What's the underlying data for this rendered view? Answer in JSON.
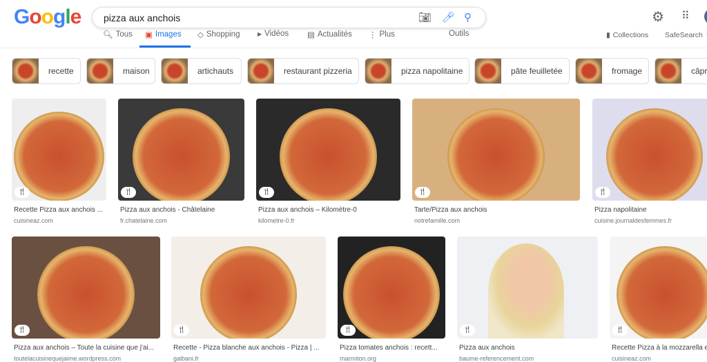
{
  "header": {
    "logo": "Google",
    "query": "pizza aux anchois",
    "icons": [
      "camera-icon",
      "mic-icon",
      "search-icon",
      "gear-icon",
      "apps-icon",
      "avatar"
    ]
  },
  "tabs": [
    {
      "label": "Tous",
      "icon": "🔍︎"
    },
    {
      "label": "Images",
      "icon": "▣",
      "active": true
    },
    {
      "label": "Shopping",
      "icon": "◇"
    },
    {
      "label": "Vidéos",
      "icon": "▶"
    },
    {
      "label": "Actualités",
      "icon": "▤"
    },
    {
      "label": "Plus",
      "icon": "⋮"
    }
  ],
  "tools": {
    "outils": "Outils",
    "collections": "Collections",
    "safesearch": "SafeSearch"
  },
  "chips": [
    "recette",
    "maison",
    "artichauts",
    "restaurant pizzeria",
    "pizza napolitaine",
    "pâte feuilletée",
    "fromage",
    "câpres"
  ],
  "results": [
    {
      "title": "Recette Pizza aux anchois ...",
      "source": "cuisineaz.com"
    },
    {
      "title": "Pizza aux anchois - Châtelaine",
      "source": "fr.chatelaine.com"
    },
    {
      "title": "Pizza aux anchois – Kilomètre-0",
      "source": "kilometre-0.fr"
    },
    {
      "title": "Tarte/Pizza aux anchois",
      "source": "notrefamille.com"
    },
    {
      "title": "Pizza napolitaine",
      "source": "cuisine.journaldesfemmes.fr"
    },
    {
      "title": "Pizza aux anchois – Toute la cuisine que j'ai...",
      "source": "toutelacuisinequejaime.wordpress.com"
    },
    {
      "title": "Recette - Pizza blanche aux anchois - Pizza | ...",
      "source": "galbani.fr"
    },
    {
      "title": "Pizza tomates anchois : recett...",
      "source": "marmiton.org"
    },
    {
      "title": "Pizza aux anchois",
      "source": "baume-referencement.com"
    },
    {
      "title": "Recette Pizza à la mozzarella et ...",
      "source": "cuisineaz.com"
    }
  ],
  "colors": {
    "accent": "#1a73e8"
  }
}
